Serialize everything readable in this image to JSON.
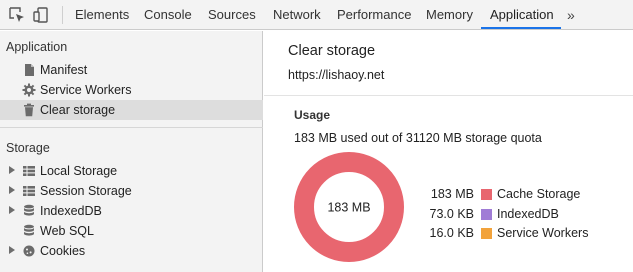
{
  "toolbar": {
    "tabs": [
      {
        "label": "Elements"
      },
      {
        "label": "Console"
      },
      {
        "label": "Sources"
      },
      {
        "label": "Network"
      },
      {
        "label": "Performance"
      },
      {
        "label": "Memory"
      },
      {
        "label": "Application"
      }
    ],
    "active_tab": "Application",
    "more_label": "»",
    "accent_color": "#1a73e8"
  },
  "sidebar": {
    "application_header": "Application",
    "application_items": [
      {
        "label": "Manifest",
        "icon": "document-icon"
      },
      {
        "label": "Service Workers",
        "icon": "gear-icon"
      },
      {
        "label": "Clear storage",
        "icon": "trash-icon"
      }
    ],
    "selected_item": "Clear storage",
    "storage_header": "Storage",
    "storage_items": [
      {
        "label": "Local Storage",
        "icon": "grid-icon",
        "expandable": true
      },
      {
        "label": "Session Storage",
        "icon": "grid-icon",
        "expandable": true
      },
      {
        "label": "IndexedDB",
        "icon": "database-icon",
        "expandable": true
      },
      {
        "label": "Web SQL",
        "icon": "database-icon",
        "expandable": false
      },
      {
        "label": "Cookies",
        "icon": "cookie-icon",
        "expandable": true
      }
    ]
  },
  "main": {
    "title": "Clear storage",
    "origin": "https://lishaoy.net",
    "usage_heading": "Usage",
    "usage_summary": "183 MB used out of 31120 MB storage quota",
    "donut_center_label": "183 MB",
    "legend": [
      {
        "value": "183 MB",
        "name": "Cache Storage",
        "color": "#e8666f"
      },
      {
        "value": "73.0 KB",
        "name": "IndexedDB",
        "color": "#a07cd6"
      },
      {
        "value": "16.0 KB",
        "name": "Service Workers",
        "color": "#f2a33c"
      }
    ]
  }
}
